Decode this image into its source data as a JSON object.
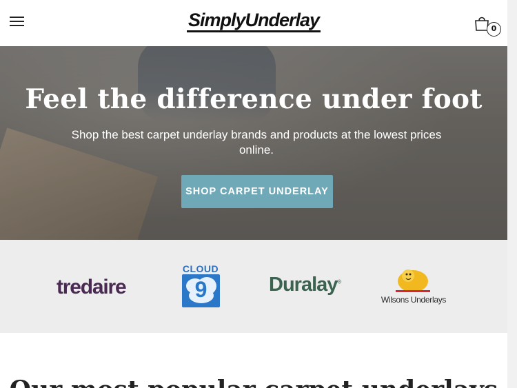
{
  "header": {
    "menu_icon": "hamburger-menu-icon",
    "logo_text": "SimplyUnderlay",
    "cart_icon": "shopping-bag-icon",
    "cart_count": "0"
  },
  "hero": {
    "title": "Feel the difference under foot",
    "subtitle": "Shop the best carpet underlay brands and products at the lowest prices online.",
    "cta_label": "SHOP CARPET UNDERLAY",
    "cta_color": "#6fa9b7"
  },
  "brands": {
    "tredaire": "tredaire",
    "cloud9_word": "CLOUD",
    "cloud9_number": "9",
    "duralay": "Duralay",
    "duralay_tm": "®",
    "wilsons": "Wilsons Underlays"
  },
  "bottom": {
    "heading": "Our most popular carpet underlays"
  }
}
